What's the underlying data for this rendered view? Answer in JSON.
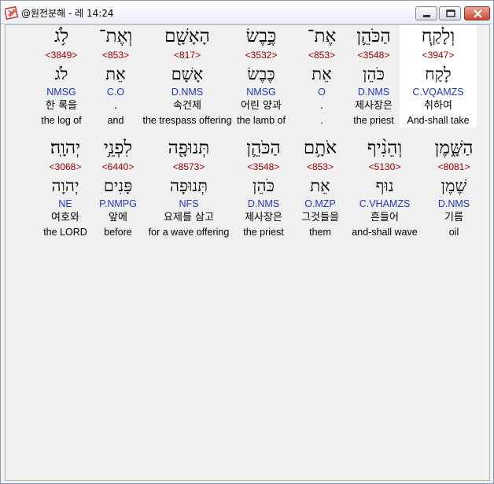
{
  "window": {
    "title": "@원전분해 - 레 14:24"
  },
  "colors": {
    "strong": "#a00000",
    "morph": "#1f36c0",
    "highlight": "#ffffff"
  },
  "rows": [
    {
      "words": [
        {
          "heb": "לֹ֥ג",
          "strong": "<3849>",
          "lemma": "לֹג",
          "morph": "NMSG",
          "kor": "한 록을",
          "eng": "the log of"
        },
        {
          "heb": "וְאֶת־",
          "strong": "<853>",
          "lemma": "אֵת",
          "morph": "C.O",
          "kor": ".",
          "eng": "and"
        },
        {
          "heb": "הָאָשָׁ֖ם",
          "strong": "<817>",
          "lemma": "אָשָׁם",
          "morph": "D.NMS",
          "kor": "속건제",
          "eng": "the trespass offering"
        },
        {
          "heb": "כֶּ֣בֶשׂ",
          "strong": "<3532>",
          "lemma": "כֶּבֶשׂ",
          "morph": "NMSG",
          "kor": "어린 양과",
          "eng": "the lamb of"
        },
        {
          "heb": "אֶת־",
          "strong": "<853>",
          "lemma": "אֵת",
          "morph": "O",
          "kor": ".",
          "eng": "."
        },
        {
          "heb": "הַכֹּהֵ֛ן",
          "strong": "<3548>",
          "lemma": "כֹּהֵן",
          "morph": "D.NMS",
          "kor": "제사장은",
          "eng": "the priest"
        },
        {
          "heb": "וְלָקַ֧ח",
          "strong": "<3947>",
          "lemma": "לָקַח",
          "morph": "C.VQAMZS",
          "kor": "취하여",
          "eng": "And-shall take",
          "highlight": true
        }
      ]
    },
    {
      "words": [
        {
          "heb": "יְהוָֽה׃",
          "strong": "<3068>",
          "lemma": "יְהוָה",
          "morph": "NE",
          "kor": "여호와",
          "eng": "the LORD"
        },
        {
          "heb": "לִפְנֵ֥י",
          "strong": "<6440>",
          "lemma": "פָּנִים",
          "morph": "P.NMPG",
          "kor": "앞에",
          "eng": "before"
        },
        {
          "heb": "תְּנוּפָ֖ה",
          "strong": "<8573>",
          "lemma": "תְּנוּפָה",
          "morph": "NFS",
          "kor": "요제를 삼고",
          "eng": "for a wave offering"
        },
        {
          "heb": "הַכֹּהֵ֛ן",
          "strong": "<3548>",
          "lemma": "כֹּהֵן",
          "morph": "D.NMS",
          "kor": "제사장은",
          "eng": "the priest"
        },
        {
          "heb": "אֹתָ֥ם",
          "strong": "<853>",
          "lemma": "אֵת",
          "morph": "O.MZP",
          "kor": "그것들을",
          "eng": "them"
        },
        {
          "heb": "וְהֵנִ֨יף",
          "strong": "<5130>",
          "lemma": "נוּף",
          "morph": "C.VHAMZS",
          "kor": "흔들어",
          "eng": "and-shall wave"
        },
        {
          "heb": "הַשָּׁ֑מֶן",
          "strong": "<8081>",
          "lemma": "שֶׁמֶן",
          "morph": "D.NMS",
          "kor": "기름",
          "eng": "oil"
        }
      ]
    }
  ]
}
